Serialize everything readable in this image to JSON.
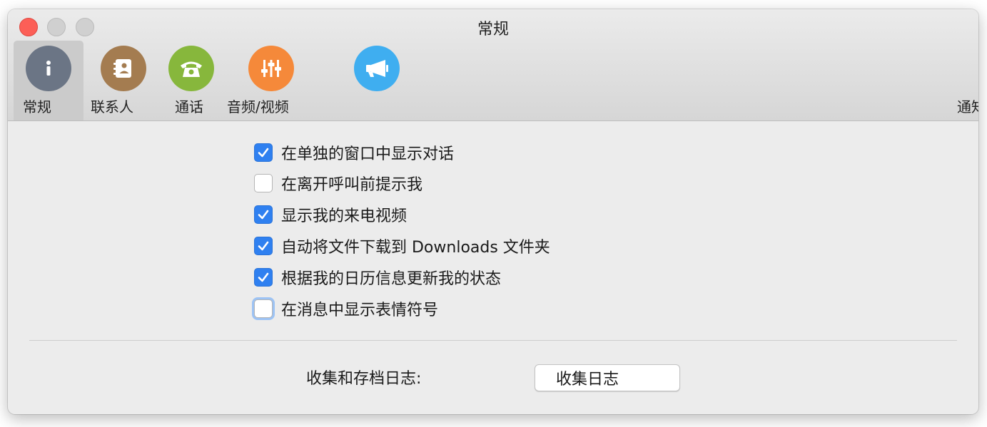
{
  "window": {
    "title": "常规"
  },
  "tabs": [
    {
      "label": "常规",
      "icon": "info-icon",
      "color": "#6b7585",
      "selected": true
    },
    {
      "label": "联系人",
      "icon": "contacts-book-icon",
      "color": "#a47c50",
      "selected": false
    },
    {
      "label": "通话",
      "icon": "phone-icon",
      "color": "#87b73c",
      "selected": false
    },
    {
      "label": "音频/视频",
      "icon": "sliders-icon",
      "color": "#f5893a",
      "selected": false
    },
    {
      "label": "",
      "icon": "megaphone-icon",
      "color": "#3faef0",
      "selected": false
    },
    {
      "label": "通知",
      "icon": "",
      "color": "",
      "selected": false
    }
  ],
  "options": [
    {
      "label": "在单独的窗口中显示对话",
      "checked": true
    },
    {
      "label": "在离开呼叫前提示我",
      "checked": false
    },
    {
      "label": "显示我的来电视频",
      "checked": true
    },
    {
      "label": "自动将文件下载到 Downloads 文件夹",
      "checked": true
    },
    {
      "label": "根据我的日历信息更新我的状态",
      "checked": true
    },
    {
      "label": "在消息中显示表情符号",
      "checked": false,
      "focused": true
    }
  ],
  "logs": {
    "label": "收集和存档日志:",
    "button_label": "收集日志"
  },
  "colors": {
    "accent": "#2f80f0",
    "close": "#fc5f57"
  }
}
